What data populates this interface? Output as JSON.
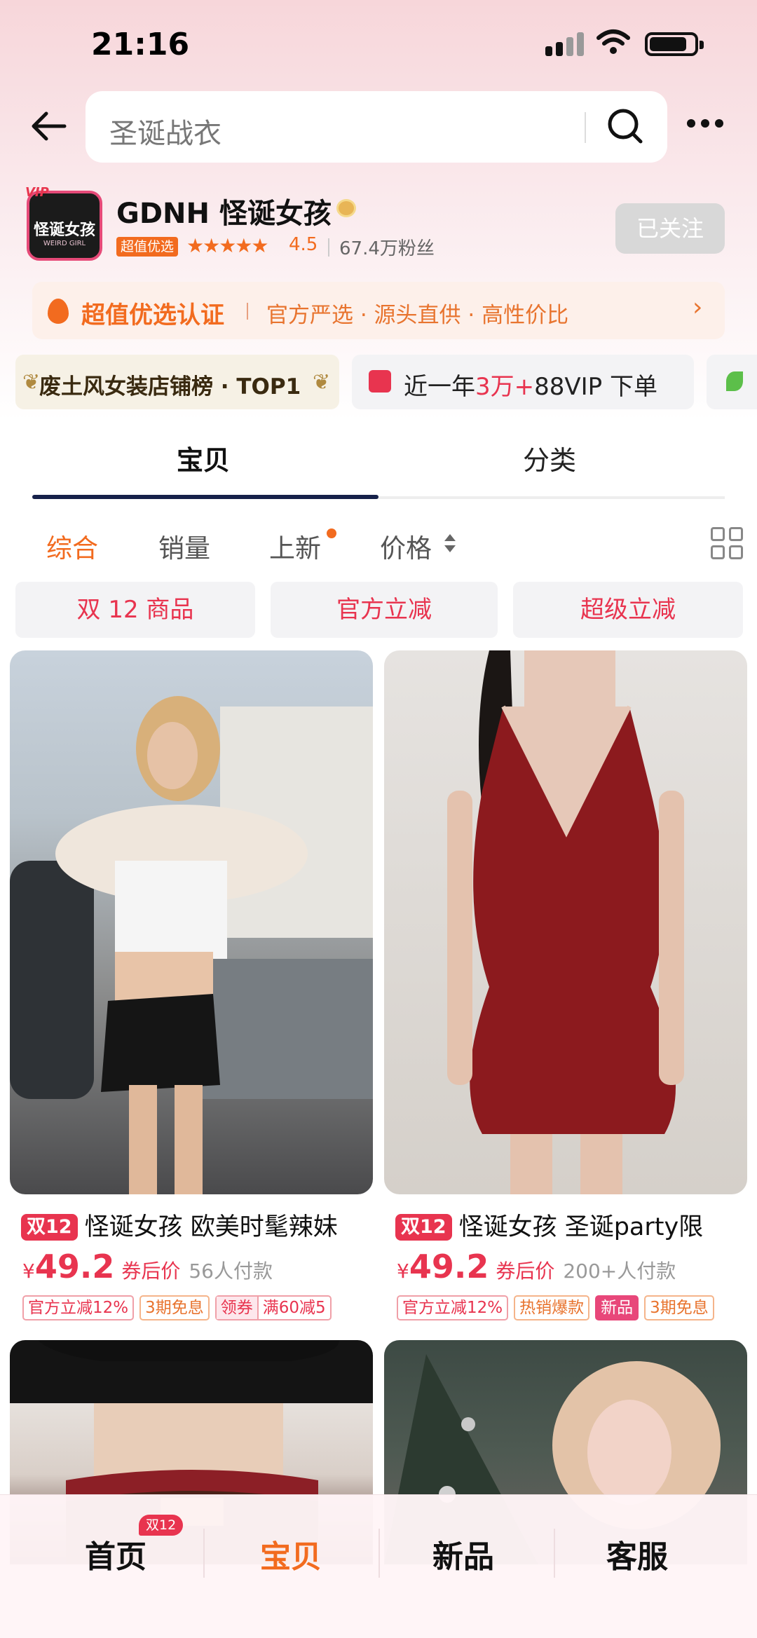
{
  "status_bar": {
    "time": "21:16"
  },
  "search": {
    "query": "圣诞战衣"
  },
  "shop": {
    "name": "GDNH 怪诞女孩",
    "logo_text": "怪诞女孩",
    "logo_subtext": "WEIRD GIRL",
    "logo_corner": "VIP",
    "badge": "超值优选",
    "stars": "★★★★★",
    "rating": "4.5",
    "fans": "67.4万粉丝",
    "follow_label": "已关注"
  },
  "certification": {
    "title": "超值优选认证",
    "desc": "官方严选 · 源头直供 · 高性价比",
    "arrow": "›"
  },
  "honors": {
    "rank": "废土风女装店铺榜 · TOP1",
    "vip_prefix": "近一年",
    "vip_highlight": "3万+",
    "vip_suffix": "88VIP 下单"
  },
  "tabs": [
    "宝贝",
    "分类"
  ],
  "sort": [
    "综合",
    "销量",
    "上新",
    "价格"
  ],
  "filters": [
    "双 12 商品",
    "官方立减",
    "超级立减"
  ],
  "products": [
    {
      "badge": "双12",
      "title": "怪诞女孩 欧美时髦辣妹",
      "currency": "¥",
      "price": "49.2",
      "price_note": "券后价",
      "paid": "56人付款",
      "tags": [
        "官方立减12%",
        "3期免息"
      ],
      "combo_tag": {
        "left": "领券",
        "right": "满60减5"
      }
    },
    {
      "badge": "双12",
      "title": "怪诞女孩 圣诞party限",
      "currency": "¥",
      "price": "49.2",
      "price_note": "券后价",
      "paid": "200+人付款",
      "tags": [
        "官方立减12%",
        "热销爆款",
        "新品",
        "3期免息"
      ]
    }
  ],
  "bottom_nav": {
    "items": [
      "首页",
      "宝贝",
      "新品",
      "客服"
    ],
    "home_badge": "双12"
  },
  "colors": {
    "accent": "#f26b1f",
    "sale_red": "#e8344f",
    "tab_underline": "#16214a"
  }
}
